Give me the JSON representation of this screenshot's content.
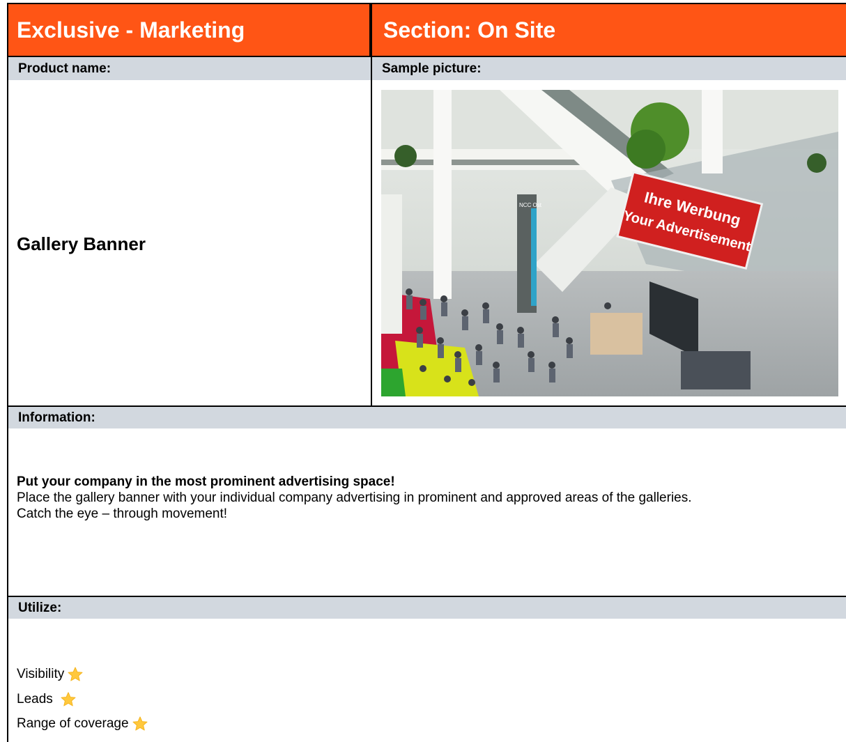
{
  "header": {
    "left_title": "Exclusive - Marketing",
    "right_title": "Section: On Site",
    "accent_color": "#ff5515"
  },
  "product": {
    "label": "Product name:",
    "name": "Gallery Banner"
  },
  "sample": {
    "label": "Sample picture:",
    "banner_line1": "Ihre Werbung",
    "banner_line2": "Your Advertisement",
    "sign_text": "NCC Ost"
  },
  "information": {
    "label": "Information:",
    "headline": "Put your company in the most prominent advertising space!",
    "line1": "Place the gallery banner with your individual company advertising in prominent and approved areas of the galleries.",
    "line2": "Catch the eye – through movement!"
  },
  "utilize": {
    "label": "Utilize:",
    "items": [
      {
        "label": "Visibility",
        "icon": "star-icon"
      },
      {
        "label": "Leads",
        "icon": "star-icon"
      },
      {
        "label": "Range of coverage",
        "icon": "star-icon"
      }
    ],
    "star_color": "#ffc83d"
  }
}
